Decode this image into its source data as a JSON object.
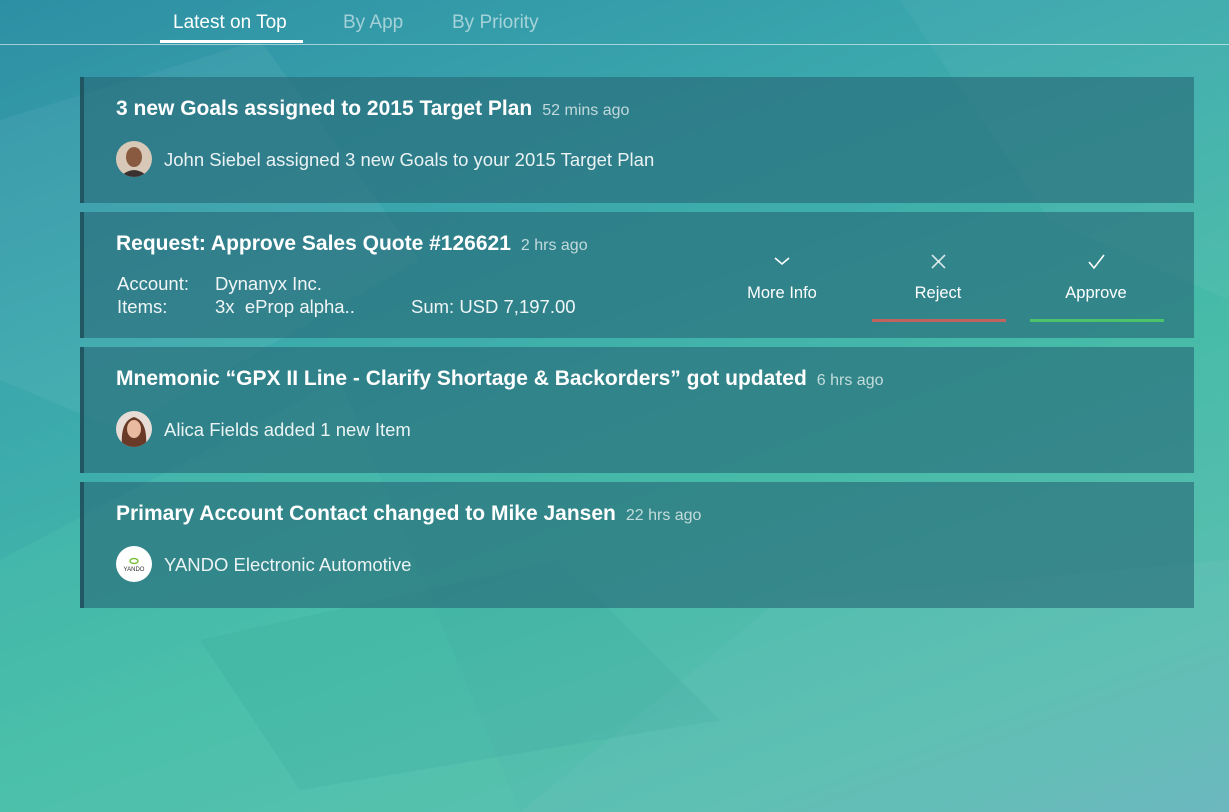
{
  "tabs": [
    {
      "label": "Latest on Top",
      "active": true
    },
    {
      "label": "By App",
      "active": false
    },
    {
      "label": "By Priority",
      "active": false
    }
  ],
  "notifications": [
    {
      "title": "3 new Goals assigned to 2015 Target Plan",
      "time": "52 mins ago",
      "subtitle": "John Siebel assigned 3 new Goals to your 2015 Target Plan",
      "avatar": "person-photo"
    },
    {
      "title": "Request: Approve Sales Quote #126621",
      "time": "2 hrs ago",
      "account_label": "Account:",
      "account_value": "Dynanyx Inc.",
      "items_label": "Items:",
      "items_value": "3x  eProp alpha..",
      "sum": "Sum: USD 7,197.00",
      "actions": {
        "more_info": "More Info",
        "reject": "Reject",
        "approve": "Approve"
      }
    },
    {
      "title": "Mnemonic “GPX II Line - Clarify Shortage & Backorders” got updated",
      "time": "6 hrs ago",
      "subtitle": "Alica Fields added 1 new Item",
      "avatar": "person-photo"
    },
    {
      "title": "Primary Account Contact changed to Mike Jansen",
      "time": "22 hrs ago",
      "subtitle": "YANDO Electronic Automotive",
      "logo_text": "YANDO"
    }
  ],
  "colors": {
    "reject_bar": "#c0635e",
    "approve_bar": "#4cc36a"
  }
}
